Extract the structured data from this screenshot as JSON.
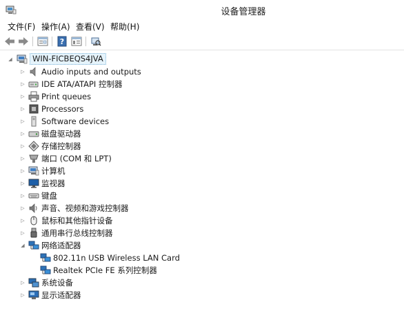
{
  "window": {
    "title": "设备管理器"
  },
  "menu": [
    {
      "id": "file",
      "label": "文件(F)"
    },
    {
      "id": "action",
      "label": "操作(A)"
    },
    {
      "id": "view",
      "label": "查看(V)"
    },
    {
      "id": "help",
      "label": "帮助(H)"
    }
  ],
  "toolbar": {
    "buttons": [
      {
        "name": "back-button",
        "icon": "arrow-left-icon"
      },
      {
        "name": "forward-button",
        "icon": "arrow-right-icon"
      },
      {
        "name": "properties-button",
        "icon": "properties-icon"
      },
      {
        "name": "help-button",
        "icon": "help-icon"
      },
      {
        "name": "details-button",
        "icon": "details-icon"
      },
      {
        "name": "scan-hardware-button",
        "icon": "scan-hardware-icon"
      }
    ]
  },
  "tree": {
    "root": {
      "label": "WIN-FICBEQS4JVA",
      "icon": "computer-icon",
      "expanded": true
    },
    "categories": [
      {
        "label": "Audio inputs and outputs",
        "icon": "speaker-icon",
        "expanded": false
      },
      {
        "label": "IDE ATA/ATAPI 控制器",
        "icon": "ide-controller-icon",
        "expanded": false
      },
      {
        "label": "Print queues",
        "icon": "printer-icon",
        "expanded": false
      },
      {
        "label": "Processors",
        "icon": "processor-icon",
        "expanded": false
      },
      {
        "label": "Software devices",
        "icon": "software-device-icon",
        "expanded": false
      },
      {
        "label": "磁盘驱动器",
        "icon": "disk-drive-icon",
        "expanded": false
      },
      {
        "label": "存储控制器",
        "icon": "storage-controller-icon",
        "expanded": false
      },
      {
        "label": "端口 (COM 和 LPT)",
        "icon": "port-icon",
        "expanded": false
      },
      {
        "label": "计算机",
        "icon": "computer-icon",
        "expanded": false
      },
      {
        "label": "监视器",
        "icon": "monitor-icon",
        "expanded": false
      },
      {
        "label": "键盘",
        "icon": "keyboard-icon",
        "expanded": false
      },
      {
        "label": "声音、视频和游戏控制器",
        "icon": "sound-icon",
        "expanded": false
      },
      {
        "label": "鼠标和其他指针设备",
        "icon": "mouse-icon",
        "expanded": false
      },
      {
        "label": "通用串行总线控制器",
        "icon": "usb-icon",
        "expanded": false
      },
      {
        "label": "网络适配器",
        "icon": "network-adapter-icon",
        "expanded": true,
        "children": [
          {
            "label": "802.11n USB Wireless LAN Card",
            "icon": "network-adapter-icon"
          },
          {
            "label": "Realtek PCIe FE 系列控制器",
            "icon": "network-adapter-icon"
          }
        ]
      },
      {
        "label": "系统设备",
        "icon": "system-device-icon",
        "expanded": false
      },
      {
        "label": "显示适配器",
        "icon": "display-adapter-icon",
        "expanded": false
      }
    ]
  }
}
